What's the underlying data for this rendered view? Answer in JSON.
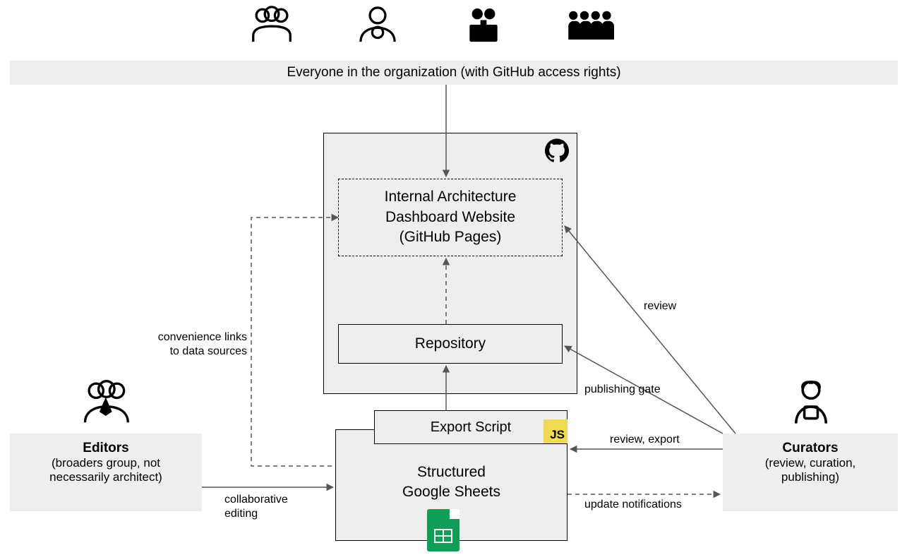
{
  "org_bar": "Everyone in the organization (with GitHub access rights)",
  "dashboard": {
    "line1": "Internal Architecture",
    "line2": "Dashboard Website",
    "line3": "(GitHub Pages)"
  },
  "repo": "Repository",
  "export_script": "Export Script",
  "sheets": {
    "line1": "Structured",
    "line2": "Google Sheets"
  },
  "editors": {
    "title": "Editors",
    "sub1": "(broaders group, not",
    "sub2": "necessarily architect)"
  },
  "curators": {
    "title": "Curators",
    "sub1": "(review, curation,",
    "sub2": "publishing)"
  },
  "labels": {
    "conv_links1": "convenience links",
    "conv_links2": "to data sources",
    "review": "review",
    "publishing_gate": "publishing gate",
    "review_export": "review, export",
    "update_notifications": "update notifications",
    "collab_editing1": "collaborative",
    "collab_editing2": "editing"
  }
}
